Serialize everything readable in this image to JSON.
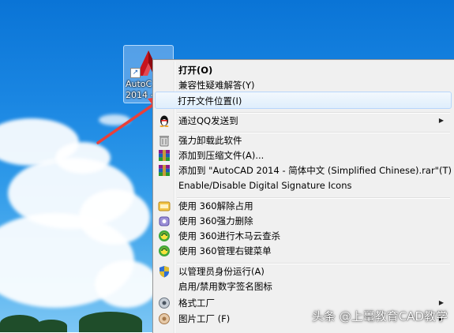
{
  "desktop": {
    "shortcut": {
      "label_line1": "AutoC",
      "label_line2": "2014 -",
      "link_glyph": "↗",
      "icon": "autocad-icon"
    }
  },
  "context_menu": {
    "items": [
      {
        "label": "打开(O)",
        "bold": true,
        "icon": ""
      },
      {
        "label": "兼容性疑难解答(Y)",
        "icon": ""
      },
      {
        "label": "打开文件位置(I)",
        "icon": "",
        "highlighted": true
      },
      {
        "label": "通过QQ发送到",
        "icon": "qq-penguin-icon",
        "submenu": true
      },
      {
        "label": "强力卸载此软件",
        "icon": "trash-icon"
      },
      {
        "label": "添加到压缩文件(A)...",
        "icon": "winrar-icon"
      },
      {
        "label": "添加到 \"AutoCAD 2014 - 简体中文 (Simplified Chinese).rar\"(T)",
        "icon": "winrar-icon"
      },
      {
        "label": "Enable/Disable Digital Signature Icons",
        "icon": ""
      },
      {
        "label": "使用 360解除占用",
        "icon": "360-unlock-icon"
      },
      {
        "label": "使用 360强力删除",
        "icon": "360-delete-icon"
      },
      {
        "label": "使用 360进行木马云查杀",
        "icon": "360-scan-icon"
      },
      {
        "label": "使用 360管理右键菜单",
        "icon": "360-menu-icon"
      },
      {
        "label": "以管理员身份运行(A)",
        "icon": "uac-shield-icon"
      },
      {
        "label": "启用/禁用数字签名图标",
        "icon": ""
      },
      {
        "label": "格式工厂",
        "icon": "format-factory-icon",
        "submenu": true
      },
      {
        "label": "图片工厂 (F)",
        "icon": "picture-factory-icon",
        "submenu": true
      }
    ],
    "submenu_glyph": "▶"
  },
  "watermark": {
    "text": "头条 @上鼍教育CAD教学"
  },
  "colors": {
    "menu_bg": "#f0f0f0",
    "highlight_border": "#b8d6fb",
    "arrow": "#e8403a"
  }
}
